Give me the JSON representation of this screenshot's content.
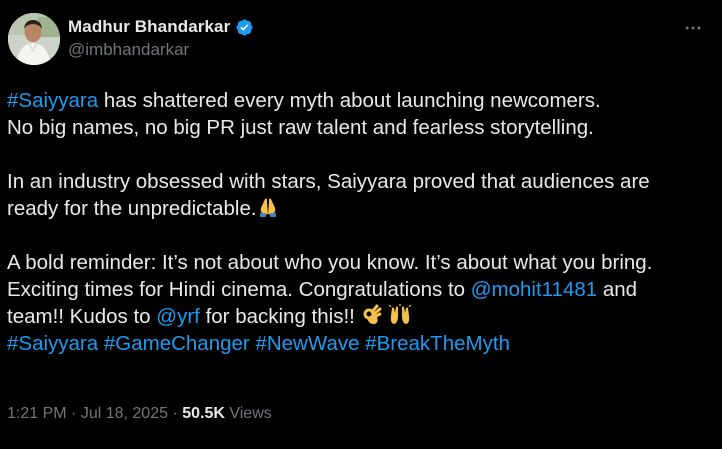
{
  "author": {
    "display_name": "Madhur Bhandarkar",
    "handle": "@imbhandarkar",
    "verified_icon": "verified-badge-icon",
    "avatar": "profile-photo"
  },
  "tweet": {
    "p1_hashtag": "#Saiyyara",
    "p1_rest": " has shattered every myth about launching newcomers.",
    "p1_line2": "No big names, no big PR just raw talent and fearless storytelling.",
    "p2_line1": "In an industry obsessed with stars, Saiyyara proved that audiences are",
    "p2_line2": "ready for the unpredictable.",
    "p2_emoji": "folded-hands-emoji",
    "p3_line1": "A bold reminder: It’s not about who you know. It’s about what you bring.",
    "p3_line2_pre": "Exciting times for Hindi cinema. Congratulations to ",
    "p3_mention1": "@mohit11481",
    "p3_line2_post": " and",
    "p3_line3_pre": "team!! Kudos to ",
    "p3_mention2": "@yrf",
    "p3_line3_post": " for backing this!! ",
    "p3_emojis": [
      "ok-hand-emoji",
      "raising-hands-emoji"
    ],
    "hashtags": [
      "#Saiyyara",
      "#GameChanger",
      "#NewWave",
      "#BreakTheMyth"
    ]
  },
  "meta": {
    "time": "1:21 PM",
    "separator": " · ",
    "date": "Jul 18, 2025",
    "views_count": "50.5K",
    "views_label": " Views"
  },
  "colors": {
    "background": "#000000",
    "text": "#e7e9ea",
    "secondary": "#71767b",
    "link": "#1d9bf0"
  },
  "icons": {
    "more": "more-options-icon"
  }
}
